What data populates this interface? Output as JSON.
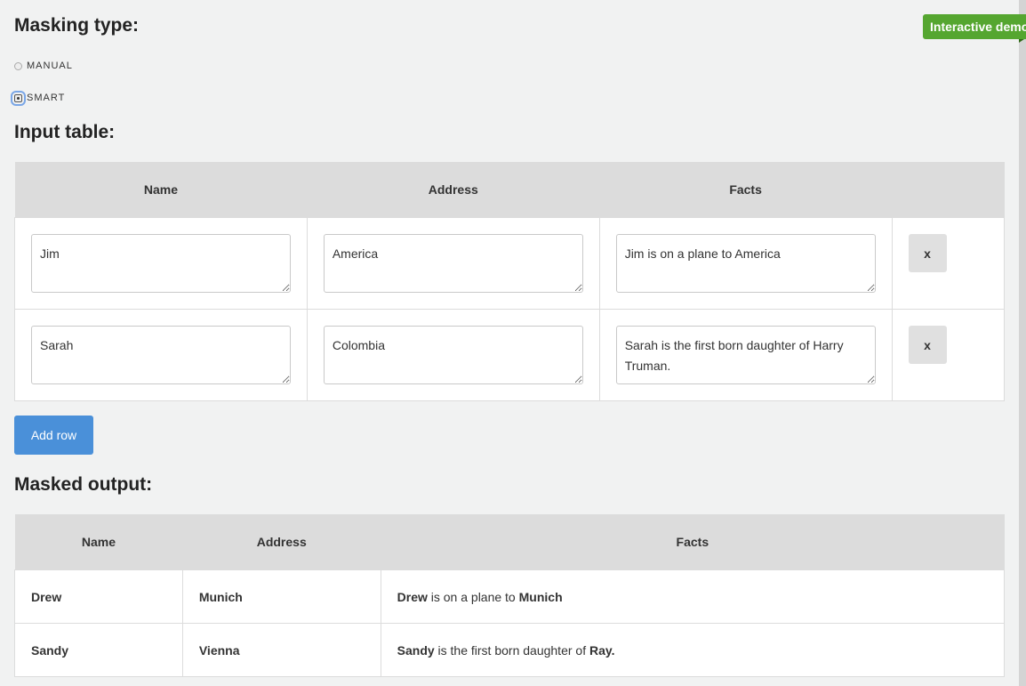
{
  "badge": "Interactive demo",
  "masking": {
    "heading": "Masking type:",
    "options": [
      {
        "label": "MANUAL",
        "checked": false
      },
      {
        "label": "SMART",
        "checked": true
      }
    ]
  },
  "input_table": {
    "heading": "Input table:",
    "columns": [
      "Name",
      "Address",
      "Facts"
    ],
    "rows": [
      {
        "name": "Jim",
        "address": "America",
        "facts": "Jim is on a plane to America",
        "remove": "x"
      },
      {
        "name": "Sarah",
        "address": "Colombia",
        "facts": "Sarah is the first born daughter of Harry Truman.",
        "remove": "x"
      }
    ],
    "add_row_label": "Add row"
  },
  "output_table": {
    "heading": "Masked output:",
    "columns": [
      "Name",
      "Address",
      "Facts"
    ],
    "rows": [
      {
        "name": "Drew",
        "address": "Munich",
        "facts": {
          "subject": "Drew",
          "middle": " is on a plane to ",
          "object": "Munich"
        }
      },
      {
        "name": "Sandy",
        "address": "Vienna",
        "facts": {
          "subject": "Sandy",
          "middle": " is the first born daughter of ",
          "object": "Ray."
        }
      }
    ]
  }
}
